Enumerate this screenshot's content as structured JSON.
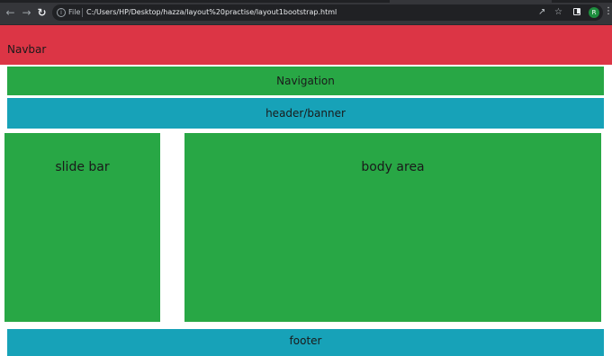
{
  "browser": {
    "url_scheme_label": "File",
    "url": "C:/Users/HP/Desktop/hazza/layout%20practise/layout1bootstrap.html",
    "profile_initial": "R",
    "icons": [
      "back-arrow-icon",
      "forward-arrow-icon",
      "reload-icon",
      "info-icon",
      "share-icon",
      "star-icon",
      "side-panel-icon",
      "menu-icon"
    ]
  },
  "page": {
    "navbar": "Navbar",
    "navigation": "Navigation",
    "header": "header/banner",
    "sidebar": "slide bar",
    "body": "body area",
    "footer": "footer"
  },
  "colors": {
    "navbar": "#dc3545",
    "green": "#28a745",
    "teal": "#17a2b8",
    "chrome": "#35363a"
  }
}
